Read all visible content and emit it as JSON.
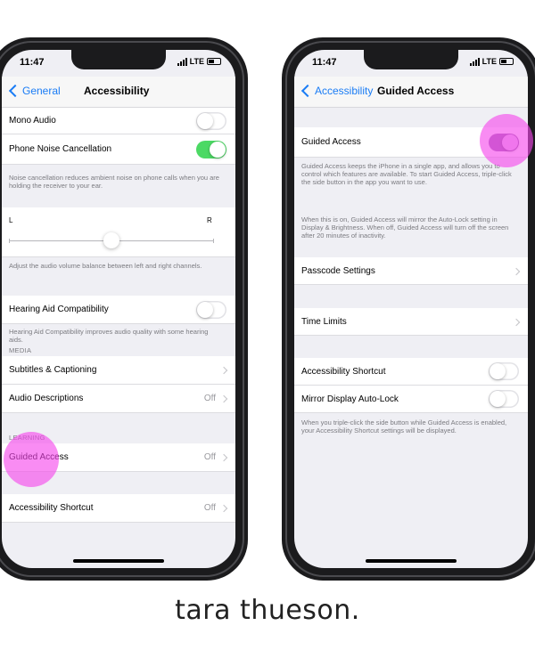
{
  "left_phone": {
    "status": {
      "time": "11:47",
      "carrier": "LTE"
    },
    "nav": {
      "back_label": "General",
      "title": "Accessibility"
    },
    "rows": {
      "mono_audio": "Mono Audio",
      "phone_noise_cancellation": "Phone Noise Cancellation",
      "noise_note": "Noise cancellation reduces ambient noise on phone calls when you are holding the receiver to your ear.",
      "slider_left": "L",
      "slider_right": "R",
      "slider_value": 0.5,
      "balance_note": "Adjust the audio volume balance between left and right channels.",
      "hearing_aid": "Hearing Aid Compatibility",
      "hearing_note": "Hearing Aid Compatibility improves audio quality with some hearing aids.",
      "media_header": "MEDIA",
      "subtitles": "Subtitles & Captioning",
      "audio_descriptions": "Audio Descriptions",
      "audio_descriptions_value": "Off",
      "learning_header": "LEARNING",
      "guided_access": "Guided Access",
      "guided_access_value": "Off",
      "accessibility_shortcut": "Accessibility Shortcut",
      "accessibility_shortcut_value": "Off"
    }
  },
  "right_phone": {
    "status": {
      "time": "11:47",
      "carrier": "LTE"
    },
    "nav": {
      "back_label": "Accessibility",
      "title": "Guided Access"
    },
    "rows": {
      "guided_access": "Guided Access",
      "guided_note": "Guided Access keeps the iPhone in a single app, and allows you to control which features are available. To start Guided Access, triple-click the side button in the app you want to use.",
      "autolock_note": "When this is on, Guided Access will mirror the Auto-Lock setting in Display & Brightness. When off, Guided Access will turn off the screen after 20 minutes of inactivity.",
      "passcode_settings": "Passcode Settings",
      "time_limits": "Time Limits",
      "accessibility_shortcut": "Accessibility Shortcut",
      "mirror_display": "Mirror Display Auto-Lock",
      "shortcut_note": "When you triple-click the side button while Guided Access is enabled, your Accessibility Shortcut settings will be displayed."
    }
  },
  "colors": {
    "accent_blue": "#1a7cf5",
    "toggle_on": "#4cd964",
    "highlight": "#f546eb"
  },
  "brand": "tara thueson."
}
